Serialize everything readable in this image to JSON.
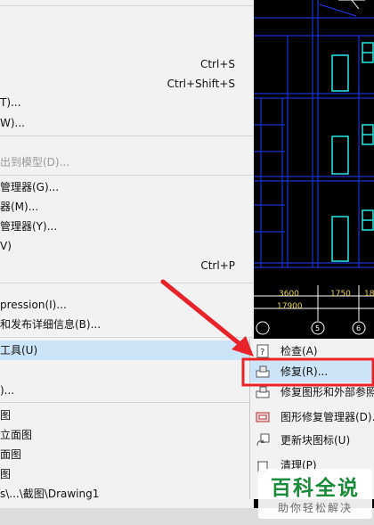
{
  "main_menu": {
    "items": [
      {
        "label": "",
        "shortcut": "Ctrl+S",
        "disabled": false
      },
      {
        "label": "",
        "shortcut": "Ctrl+Shift+S",
        "disabled": false
      },
      {
        "label": "T)...",
        "shortcut": "",
        "disabled": false
      },
      {
        "label": "W)...",
        "shortcut": "",
        "disabled": false
      },
      {
        "label": "出到模型(D)...",
        "shortcut": "",
        "disabled": true
      },
      {
        "label": "管理器(G)...",
        "shortcut": "",
        "disabled": false
      },
      {
        "label": "器(M)...",
        "shortcut": "",
        "disabled": false
      },
      {
        "label": "管理器(Y)...",
        "shortcut": "",
        "disabled": false
      },
      {
        "label": "V)",
        "shortcut": "",
        "disabled": false
      },
      {
        "label": "",
        "shortcut": "Ctrl+P",
        "disabled": false
      },
      {
        "label": "pression(I)...",
        "shortcut": "",
        "disabled": false
      },
      {
        "label": "和发布详细信息(B)...",
        "shortcut": "",
        "disabled": false
      },
      {
        "label": "工具(U)",
        "shortcut": "",
        "disabled": false,
        "highlighted": true
      },
      {
        "label": ")...",
        "shortcut": "",
        "disabled": false
      },
      {
        "label": "图",
        "shortcut": "",
        "disabled": false
      },
      {
        "label": "立面图",
        "shortcut": "",
        "disabled": false
      },
      {
        "label": "面图",
        "shortcut": "",
        "disabled": false
      },
      {
        "label": "图",
        "shortcut": "",
        "disabled": false
      },
      {
        "label": "s\\...\\截图\\Drawing1",
        "shortcut": "",
        "disabled": false
      }
    ]
  },
  "submenu": {
    "items": [
      {
        "label": "检查(A)",
        "icon": "audit-icon"
      },
      {
        "label": "修复(R)...",
        "icon": "recover-icon",
        "highlighted": true
      },
      {
        "label": "修复图形和外部参照",
        "icon": "recover-xref-icon"
      },
      {
        "label": "图形修复管理器(D)...",
        "icon": "recovery-manager-icon"
      },
      {
        "label": "更新块图标(U)",
        "icon": "update-block-icon"
      },
      {
        "label": "清理(P)",
        "icon": "purge-icon"
      }
    ]
  },
  "drawing": {
    "dimensions": [
      "3600",
      "1750",
      "18",
      "17900"
    ],
    "axis_labels": [
      "5",
      "6"
    ]
  },
  "watermark": {
    "title": "百科全说",
    "subtitle": "助你轻松解决"
  },
  "colors": {
    "menu_bg": "#f2f2f2",
    "highlight": "#cce4f7",
    "cad_bg": "#000000",
    "cad_blue": "#1f3bff",
    "cad_cyan": "#27e8e8",
    "annotation_red": "#e8232a",
    "watermark_green": "#1b8a3a"
  }
}
